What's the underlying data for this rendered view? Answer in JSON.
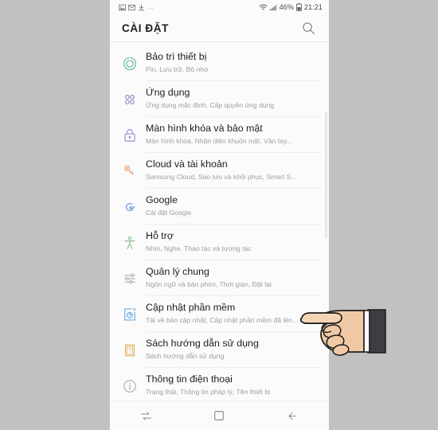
{
  "statusbar": {
    "left_icons": [
      "image-notification-icon",
      "message-notification-icon",
      "download-notification-icon"
    ],
    "overflow": "...",
    "wifi_icon": "wifi-icon",
    "signal_icon": "signal-icon",
    "battery_percent": "46%",
    "battery_icon": "battery-icon",
    "clock": "21:21"
  },
  "header": {
    "title": "CÀI ĐẶT",
    "search_icon": "search-icon"
  },
  "settings": {
    "items": [
      {
        "icon": "device-maintenance-icon",
        "icon_color": "#63b4a8",
        "title": "Bảo trì thiết bị",
        "subtitle": "Pin, Lưu trữ, Bộ nhớ"
      },
      {
        "icon": "apps-icon",
        "icon_color": "#8c8ccc",
        "title": "Ứng dụng",
        "subtitle": "Ứng dụng mặc định, Cấp quyền ứng dụng"
      },
      {
        "icon": "lock-screen-security-icon",
        "icon_color": "#9b8fd4",
        "title": "Màn hình khóa và bảo mật",
        "subtitle": "Màn hình khóa, Nhận diện khuôn mặt, Vân tay..."
      },
      {
        "icon": "cloud-accounts-key-icon",
        "icon_color": "#e8a87c",
        "title": "Cloud và tài khoản",
        "subtitle": "Samsung Cloud, Sao lưu và khôi phục, Smart S..."
      },
      {
        "icon": "google-icon",
        "icon_color": "#6d9fe0",
        "title": "Google",
        "subtitle": "Cài đặt Google"
      },
      {
        "icon": "accessibility-icon",
        "icon_color": "#8cc48c",
        "title": "Hỗ trợ",
        "subtitle": "Nhìn, Nghe, Thao tác và tương tác"
      },
      {
        "icon": "general-management-sliders-icon",
        "icon_color": "#a8a8a8",
        "title": "Quản lý chung",
        "subtitle": "Ngôn ngữ và bàn phím, Thời gian, Đặt lại"
      },
      {
        "icon": "software-update-icon",
        "icon_color": "#6aa9e0",
        "title": "Cập nhật phần mềm",
        "subtitle": "Tải về bản cập nhật, Cập nhật phần mềm đã lên..."
      },
      {
        "icon": "user-manual-icon",
        "icon_color": "#e0b060",
        "title": "Sách hướng dẫn sử dụng",
        "subtitle": "Sách hướng dẫn sử dụng"
      },
      {
        "icon": "phone-info-icon",
        "icon_color": "#a8a8a8",
        "title": "Thông tin điện thoại",
        "subtitle": "Trạng thái, Thông tin pháp lý, Tên thiết bị"
      }
    ]
  },
  "navbar": {
    "recents_icon": "recents-icon",
    "home_icon": "home-icon",
    "back_icon": "back-icon"
  },
  "cursor": {
    "type": "pointing-hand-cursor",
    "points_at": "Cập nhật phần mềm"
  }
}
